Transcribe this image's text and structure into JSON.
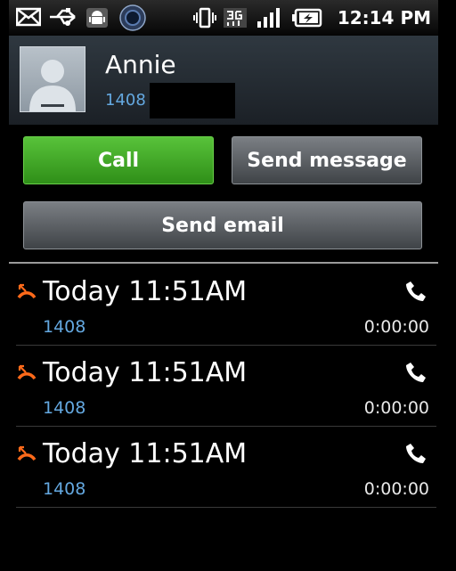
{
  "status_bar": {
    "time": "12:14 PM",
    "icons": [
      "mail-icon",
      "usb-icon",
      "android-debug-icon",
      "app-icon",
      "vibrate-icon",
      "3g-icon",
      "signal-icon",
      "battery-charging-icon"
    ]
  },
  "contact": {
    "name": "Annie",
    "number": "1408"
  },
  "actions": {
    "call_label": "Call",
    "message_label": "Send message",
    "email_label": "Send email"
  },
  "call_log": [
    {
      "time": "Today 11:51AM",
      "number": "1408",
      "duration": "0:00:00",
      "type": "missed"
    },
    {
      "time": "Today 11:51AM",
      "number": "1408",
      "duration": "0:00:00",
      "type": "missed"
    },
    {
      "time": "Today 11:51AM",
      "number": "1408",
      "duration": "0:00:00",
      "type": "missed"
    }
  ],
  "colors": {
    "call_green": "#3aa423",
    "link_blue": "#64a8e0",
    "missed_orange": "#ff6a1a"
  }
}
